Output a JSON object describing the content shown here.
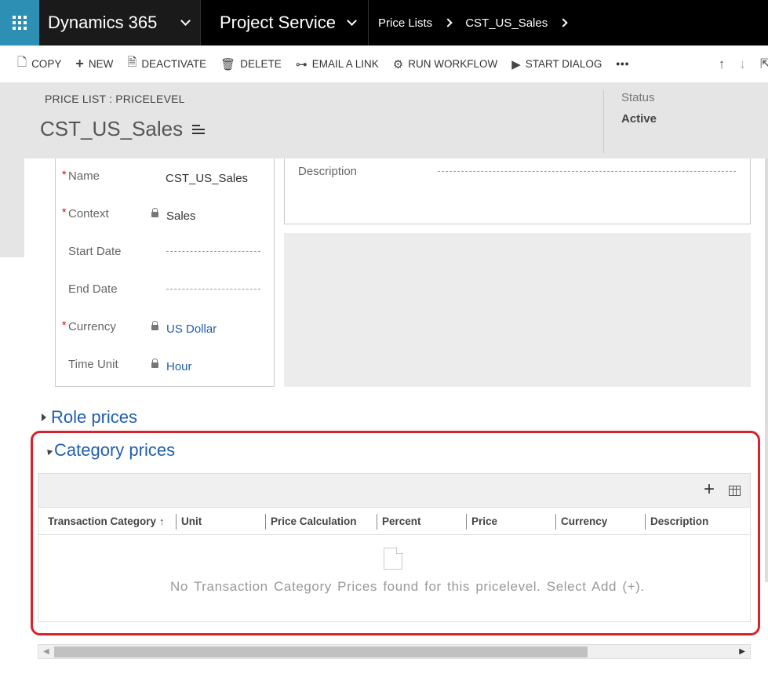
{
  "nav": {
    "brand": "Dynamics 365",
    "module": "Project Service",
    "breadcrumbs": [
      "Price Lists",
      "CST_US_Sales"
    ]
  },
  "commands": {
    "copy": "COPY",
    "new": "NEW",
    "deactivate": "DEACTIVATE",
    "delete": "DELETE",
    "email_link": "EMAIL A LINK",
    "run_workflow": "RUN WORKFLOW",
    "start_dialog": "START DIALOG",
    "more": "•••"
  },
  "header": {
    "entity": "PRICE LIST : PRICELEVEL",
    "title": "CST_US_Sales",
    "status_label": "Status",
    "status_value": "Active"
  },
  "form": {
    "name_label": "Name",
    "name_value": "CST_US_Sales",
    "context_label": "Context",
    "context_value": "Sales",
    "start_date_label": "Start Date",
    "end_date_label": "End Date",
    "currency_label": "Currency",
    "currency_value": "US Dollar",
    "time_unit_label": "Time Unit",
    "time_unit_value": "Hour",
    "description_label": "Description",
    "required_marker": "*"
  },
  "sections": {
    "role_prices": "Role prices",
    "category_prices": "Category prices"
  },
  "grid": {
    "add": "+",
    "columns": [
      "Transaction Category",
      "Unit",
      "Price Calculation",
      "Percent",
      "Price",
      "Currency",
      "Description"
    ],
    "sort_indicator": "↑",
    "empty_message": "No Transaction Category Prices found for this pricelevel. Select Add (+)."
  },
  "colors": {
    "accent": "#2e8fb5",
    "link": "#1f5fad",
    "highlight": "#d9222a",
    "required": "#cc0000"
  }
}
